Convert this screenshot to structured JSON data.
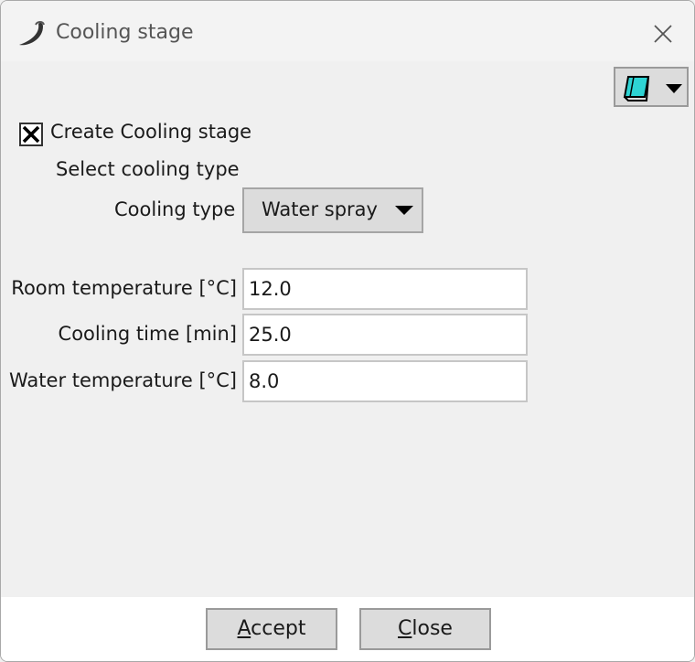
{
  "window": {
    "title": "Cooling stage"
  },
  "toolbar": {
    "menu_icon": "notebook-icon"
  },
  "create_stage": {
    "label": "Create Cooling stage",
    "checked": true
  },
  "cooling": {
    "select_label": "Select cooling type",
    "type_label": "Cooling type",
    "type_value": "Water spray"
  },
  "fields": {
    "room_temp_label": "Room temperature [°C]",
    "room_temp_value": "12.0",
    "cooling_time_label": "Cooling time [min]",
    "cooling_time_value": "25.0",
    "water_temp_label": "Water temperature [°C]",
    "water_temp_value": "8.0"
  },
  "buttons": {
    "accept_first": "A",
    "accept_rest": "ccept",
    "close_first": "C",
    "close_rest": "lose"
  }
}
